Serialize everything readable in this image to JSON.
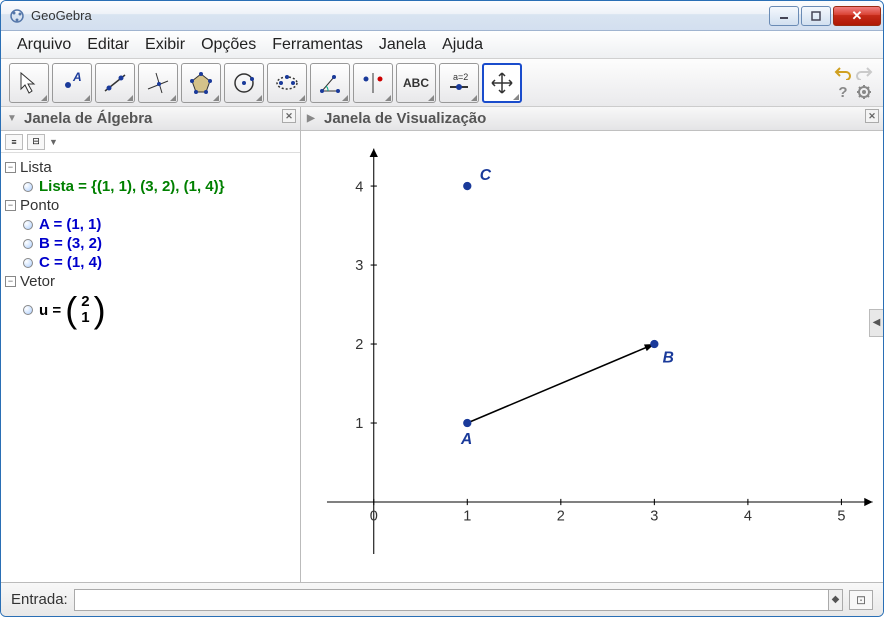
{
  "app": {
    "title": "GeoGebra"
  },
  "menu": {
    "arquivo": "Arquivo",
    "editar": "Editar",
    "exibir": "Exibir",
    "opcoes": "Opções",
    "ferramentas": "Ferramentas",
    "janela": "Janela",
    "ajuda": "Ajuda"
  },
  "panels": {
    "algebra_title": "Janela de Álgebra",
    "graphics_title": "Janela de Visualização"
  },
  "algebra": {
    "groups": {
      "lista": {
        "label": "Lista",
        "items": {
          "lista_def": "Lista = {(1, 1), (3, 2), (1, 4)}"
        }
      },
      "ponto": {
        "label": "Ponto",
        "items": {
          "a": "A = (1, 1)",
          "b": "B = (3, 2)",
          "c": "C = (1, 4)"
        }
      },
      "vetor": {
        "label": "Vetor",
        "items": {
          "u_prefix": "u  =",
          "u_top": "2",
          "u_bot": "1"
        }
      }
    }
  },
  "chart_data": {
    "type": "scatter",
    "title": "",
    "xlabel": "",
    "ylabel": "",
    "xlim": [
      -0.5,
      6
    ],
    "ylim": [
      -0.5,
      4.5
    ],
    "x_ticks": [
      0,
      1,
      2,
      3,
      4,
      5
    ],
    "y_ticks": [
      0,
      1,
      2,
      3,
      4
    ],
    "points": [
      {
        "name": "A",
        "x": 1,
        "y": 1
      },
      {
        "name": "B",
        "x": 3,
        "y": 2
      },
      {
        "name": "C",
        "x": 1,
        "y": 4
      }
    ],
    "vectors": [
      {
        "name": "u",
        "from": [
          1,
          1
        ],
        "to": [
          3,
          2
        ]
      }
    ]
  },
  "input": {
    "label": "Entrada:",
    "value": ""
  },
  "toolbar_text": {
    "abc": "ABC",
    "a2": "a=2"
  }
}
